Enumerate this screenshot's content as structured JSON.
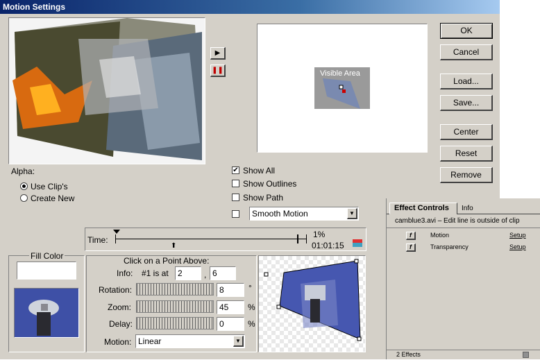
{
  "window": {
    "title": "Motion Settings"
  },
  "preview": {
    "visible_area_label": "Visible Area"
  },
  "buttons": {
    "ok": "OK",
    "cancel": "Cancel",
    "load": "Load...",
    "save": "Save...",
    "center": "Center",
    "reset": "Reset",
    "remove": "Remove"
  },
  "alpha": {
    "label": "Alpha:",
    "use_clips": "Use Clip's",
    "create_new": "Create New",
    "selected": "use_clips"
  },
  "options": {
    "show_all": "Show All",
    "show_outlines": "Show Outlines",
    "show_path": "Show Path",
    "smooth_motion": "Smooth Motion",
    "show_all_checked": true
  },
  "time": {
    "label": "Time:",
    "percent": "1%",
    "timecode": "01:01:15"
  },
  "fill_color": {
    "label": "Fill Color"
  },
  "point": {
    "header": "Click on a Point Above:",
    "info_label": "Info:",
    "info_text": "#1 is at",
    "x": "2",
    "y": "6",
    "rotation_label": "Rotation:",
    "rotation": "8",
    "rotation_unit": "°",
    "zoom_label": "Zoom:",
    "zoom": "45",
    "zoom_unit": "%",
    "delay_label": "Delay:",
    "delay": "0",
    "delay_unit": "%",
    "motion_label": "Motion:",
    "motion": "Linear"
  },
  "effect_controls": {
    "tabs": [
      "Effect Controls",
      "Info"
    ],
    "clip": "camblue3.avi – Edit line is outside of clip",
    "effects": [
      {
        "name": "Motion",
        "setup": "Setup"
      },
      {
        "name": "Transparency",
        "setup": "Setup"
      }
    ],
    "footer": "2 Effects"
  }
}
